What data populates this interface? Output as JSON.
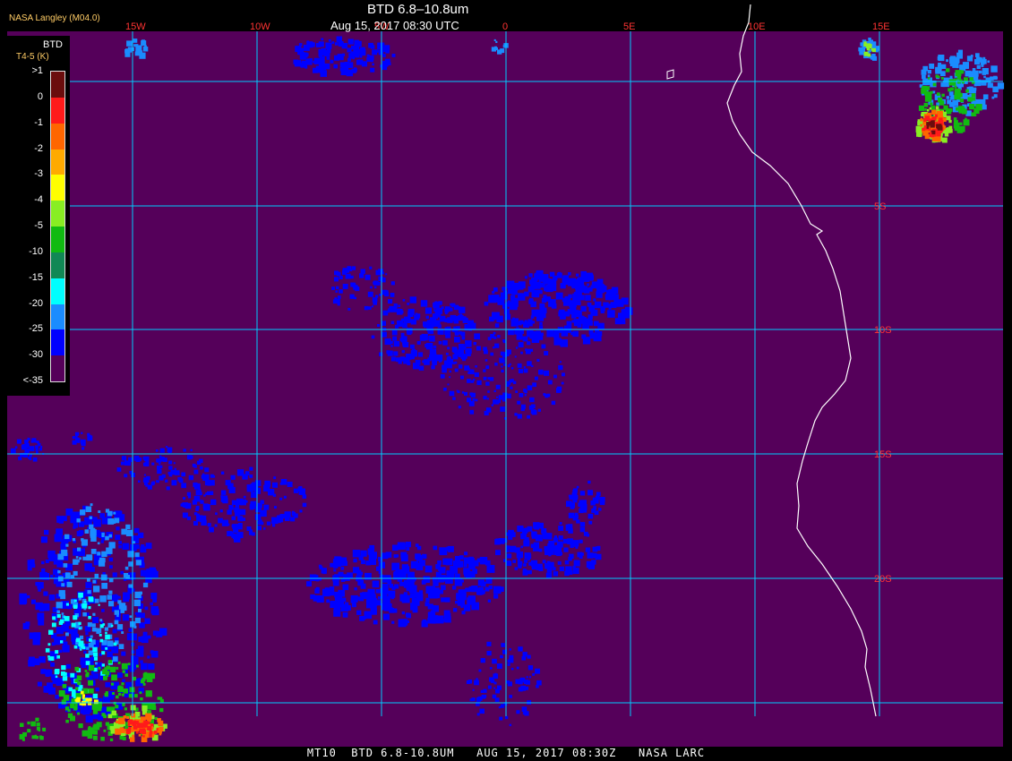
{
  "header": {
    "agency": "NASA Langley (M04.0)",
    "title": "BTD 6.8–10.8um",
    "timestamp": "Aug 15, 2017 08:30 UTC"
  },
  "footer": {
    "caption": "MT10  BTD 6.8-10.8UM   AUG 15, 2017 08:30Z   NASA LARC"
  },
  "legend": {
    "title": "BTD",
    "subtitle": "T4-5 (K)",
    "labels": [
      ">1",
      "0",
      "-1",
      "-2",
      "-3",
      "-4",
      "-5",
      "-10",
      "-15",
      "-20",
      "-25",
      "-30",
      "<-35"
    ],
    "colors": [
      "#6b0d0d",
      "#ff1a1a",
      "#ff6600",
      "#ffaa00",
      "#ffff00",
      "#88ee22",
      "#11bb11",
      "#118855",
      "#00ffff",
      "#1a8cff",
      "#0000ff",
      "#55005a"
    ]
  },
  "map": {
    "background_color": "#55005a",
    "grid_color": "#00ccff",
    "coast_color": "#ffffff",
    "longitude_labels": [
      "15W",
      "10W",
      "5W",
      "0",
      "5E",
      "10E",
      "15E"
    ],
    "latitude_labels": [
      "5S",
      "10S",
      "15S",
      "20S"
    ]
  }
}
